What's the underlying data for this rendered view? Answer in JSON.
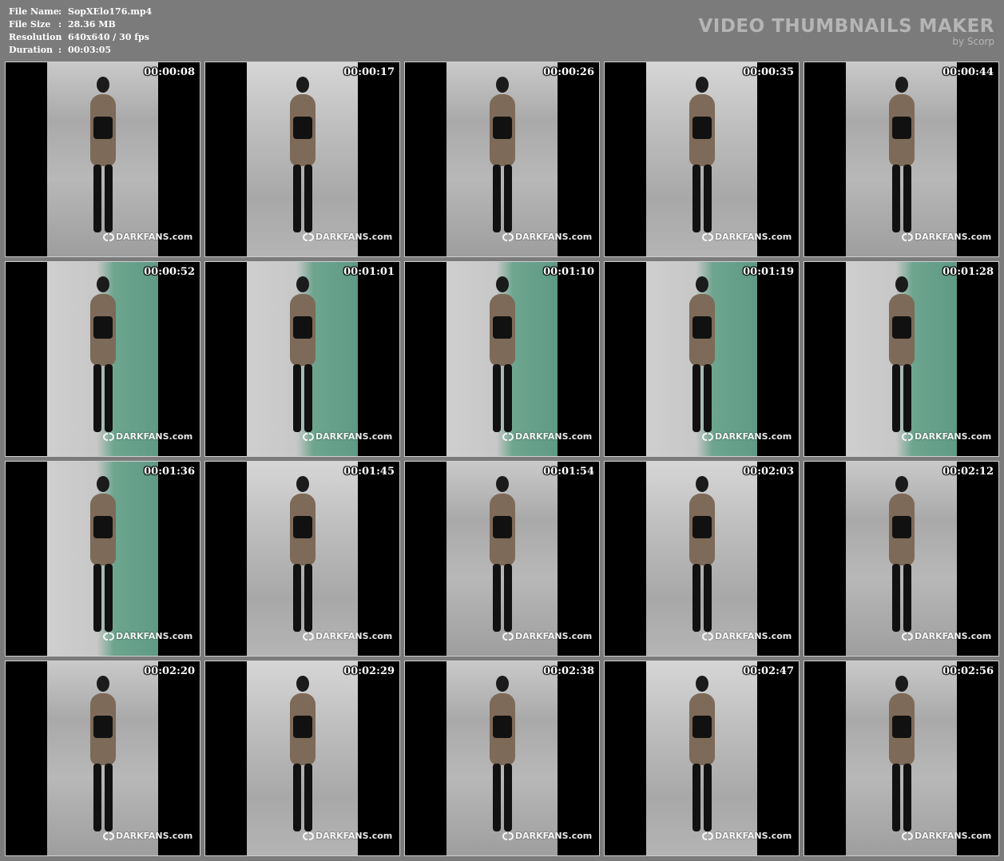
{
  "info": {
    "rows": [
      {
        "label": "File Name",
        "sep": ":",
        "value": "SopXElo176.mp4"
      },
      {
        "label": "File Size",
        "sep": ":",
        "value": "28.36 MB"
      },
      {
        "label": "Resolution",
        "sep": ":",
        "value": "640x640 / 30 fps"
      },
      {
        "label": "Duration",
        "sep": ":",
        "value": "00:03:05"
      }
    ]
  },
  "brand": {
    "title": "VIDEO THUMBNAILS MAKER",
    "subtitle": "by Scorp"
  },
  "watermark_text": "DARKFANS.com",
  "thumbnails": [
    {
      "time": "00:00:08"
    },
    {
      "time": "00:00:17"
    },
    {
      "time": "00:00:26"
    },
    {
      "time": "00:00:35"
    },
    {
      "time": "00:00:44"
    },
    {
      "time": "00:00:52"
    },
    {
      "time": "00:01:01"
    },
    {
      "time": "00:01:10"
    },
    {
      "time": "00:01:19"
    },
    {
      "time": "00:01:28"
    },
    {
      "time": "00:01:36"
    },
    {
      "time": "00:01:45"
    },
    {
      "time": "00:01:54"
    },
    {
      "time": "00:02:03"
    },
    {
      "time": "00:02:12"
    },
    {
      "time": "00:02:20"
    },
    {
      "time": "00:02:29"
    },
    {
      "time": "00:02:38"
    },
    {
      "time": "00:02:47"
    },
    {
      "time": "00:02:56"
    }
  ]
}
